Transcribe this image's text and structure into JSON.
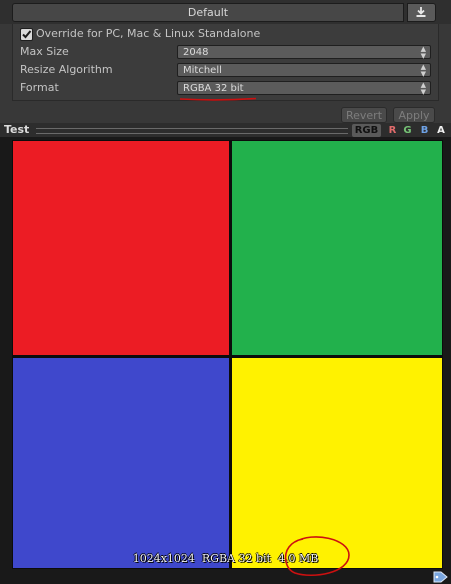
{
  "platform_tab": {
    "label": "Default"
  },
  "override": {
    "checked": true,
    "label": "Override for PC, Mac & Linux Standalone"
  },
  "settings": {
    "max_size": {
      "label": "Max Size",
      "value": "2048"
    },
    "resize_algorithm": {
      "label": "Resize Algorithm",
      "value": "Mitchell"
    },
    "format": {
      "label": "Format",
      "value": "RGBA 32 bit"
    }
  },
  "buttons": {
    "revert": "Revert",
    "apply": "Apply"
  },
  "preview": {
    "title": "Test",
    "channels": {
      "rgb": "RGB",
      "r": "R",
      "g": "G",
      "b": "B",
      "a": "A"
    },
    "info": "1024x1024  RGBA 32 bit  4.0 MB",
    "quadrant_colors": {
      "top_left": "#ec1c24",
      "top_right": "#22b14c",
      "bottom_left": "#3f48cc",
      "bottom_right": "#fff200"
    }
  },
  "annotation_color": "#cc1010",
  "icons": {
    "download": "download-icon",
    "checkmark": "checkmark-icon",
    "tag": "tag-icon"
  }
}
